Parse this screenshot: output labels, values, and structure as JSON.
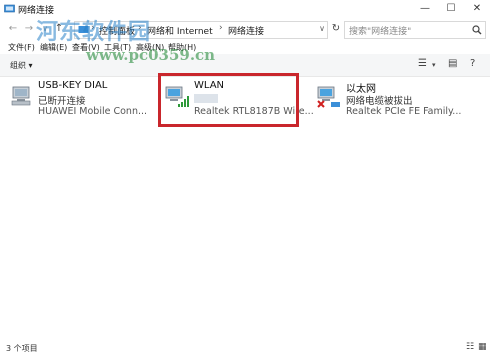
{
  "window": {
    "title": "网络连接",
    "minimize": "—",
    "maximize": "☐",
    "close": "✕"
  },
  "nav": {
    "back": "←",
    "forward": "→",
    "up": "↑",
    "breadcrumbs": [
      "控制面板",
      "网络和 Internet",
      "网络连接"
    ],
    "dropdown": "∨",
    "refresh": "↻",
    "search_placeholder": "搜索\"网络连接\"",
    "search_icon": "search-icon"
  },
  "menubar": {
    "items": [
      "文件(F)",
      "编辑(E)",
      "查看(V)",
      "工具(T)",
      "高级(N)",
      "帮助(H)"
    ]
  },
  "cmdbar": {
    "organize": "组织"
  },
  "connections": [
    {
      "name": "USB-KEY DIAL",
      "status": "已断开连接",
      "adapter": "HUAWEI Mobile Conn..."
    },
    {
      "name": "WLAN",
      "status": "",
      "adapter": "Realtek RTL8187B Wire..."
    },
    {
      "name": "以太网",
      "status": "网络电缆被拔出",
      "adapter": "Realtek PCIe FE Family..."
    }
  ],
  "statusbar": {
    "count": "3 个项目"
  },
  "watermark": {
    "text": "河东软件园",
    "url": "www.pc0359.cn"
  },
  "colors": {
    "highlight": "#c9262c",
    "accent": "#1e7ad6"
  }
}
